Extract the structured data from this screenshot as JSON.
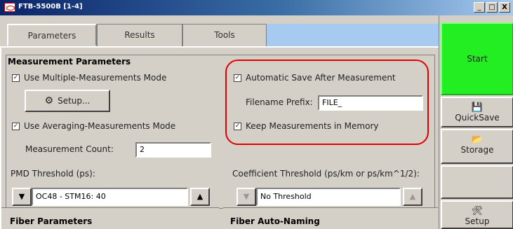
{
  "window": {
    "title": "FTB-5500B [1-4]",
    "controls": [
      "_",
      "□",
      "X"
    ]
  },
  "tabs": [
    {
      "label": "Parameters",
      "active": true
    },
    {
      "label": "Results",
      "active": false
    },
    {
      "label": "Tools",
      "active": false
    }
  ],
  "measurement": {
    "title": "Measurement Parameters",
    "multi_mode_label": "Use Multiple-Measurements Mode",
    "multi_mode_checked": true,
    "setup_label": "Setup...",
    "averaging_label": "Use Averaging-Measurements Mode",
    "averaging_checked": true,
    "count_label": "Measurement Count:",
    "count_value": "2",
    "auto_save_label": "Automatic Save After Measurement",
    "auto_save_checked": true,
    "prefix_label": "Filename Prefix:",
    "prefix_value": "FILE_",
    "keep_label": "Keep Measurements in Memory",
    "keep_checked": true,
    "pmd_label": "PMD Threshold (ps):",
    "pmd_value": "OC48 - STM16: 40",
    "coef_label": "Coefficient Threshold (ps/km or ps/km^1/2):",
    "coef_value": "No Threshold"
  },
  "bottom": {
    "fiber_params": "Fiber Parameters",
    "fiber_naming": "Fiber Auto-Naming"
  },
  "side": {
    "start": "Start",
    "quicksave": "QuickSave",
    "storage": "Storage",
    "setup": "Setup"
  },
  "colors": {
    "start_bg": "#22ee22",
    "highlight": "#e30000",
    "title_bar": "#0a246a"
  }
}
